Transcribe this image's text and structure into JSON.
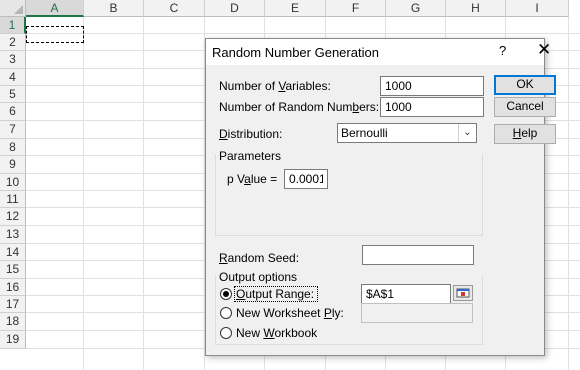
{
  "spreadsheet": {
    "columns": [
      "A",
      "B",
      "C",
      "D",
      "E",
      "F",
      "G",
      "H",
      "I"
    ],
    "rows": [
      "1",
      "2",
      "3",
      "4",
      "5",
      "6",
      "7",
      "8",
      "9",
      "10",
      "11",
      "12",
      "13",
      "14",
      "15",
      "16",
      "17",
      "18",
      "19"
    ],
    "active_cell": "A1"
  },
  "dialog": {
    "title": "Random Number Generation",
    "help_glyph": "?",
    "close_glyph": "✕",
    "num_variables": {
      "label": "Number of Variables:",
      "value": "1000"
    },
    "num_random_numbers": {
      "label": "Number of Random Numbers:",
      "value": "1000"
    },
    "distribution": {
      "label": "Distribution:",
      "value": "Bernoulli"
    },
    "parameters": {
      "label": "Parameters",
      "p_value_label": "p Value =",
      "p_value": "0.0001"
    },
    "random_seed": {
      "label": "Random Seed:",
      "value": ""
    },
    "output_options": {
      "label": "Output options",
      "output_range": {
        "label": "Output Range:",
        "value": "$A$1",
        "selected": true
      },
      "new_worksheet": {
        "label": "New Worksheet Ply:",
        "value": "",
        "selected": false
      },
      "new_workbook": {
        "label": "New Workbook",
        "selected": false
      }
    },
    "buttons": {
      "ok": "OK",
      "cancel": "Cancel",
      "help": "Help"
    }
  }
}
